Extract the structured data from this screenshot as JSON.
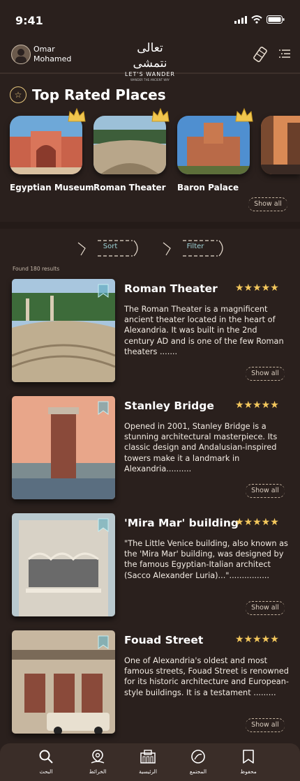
{
  "status": {
    "time": "9:41"
  },
  "header": {
    "user_name": "Omar Mohamed",
    "logo_ar": "تعالى نتمشى",
    "logo_en": "LET'S WANDER",
    "logo_sub": "WANDER THE ANCIENT WAY",
    "map_icon": "scroll-map-icon",
    "menu_icon": "menu-icon"
  },
  "top_rated": {
    "title": "Top Rated Places",
    "places": [
      {
        "name": "Egyptian Museum"
      },
      {
        "name": "Roman Theater"
      },
      {
        "name": "Baron Palace"
      },
      {
        "name": ""
      }
    ],
    "show_all": "Show all"
  },
  "controls": {
    "sort": "Sort",
    "filter": "Filter",
    "found": "Found 180 results"
  },
  "results": [
    {
      "name": "Roman Theater",
      "stars": "★★★★★",
      "desc": "The Roman Theater is a magnificent ancient theater located in the heart of Alexandria. It was built in the 2nd century AD and is one of the few Roman theaters .......",
      "show_all": "Show all"
    },
    {
      "name": "Stanley Bridge",
      "stars": "★★★★★",
      "desc": "Opened in 2001, Stanley Bridge is a stunning architectural masterpiece. Its classic design and Andalusian-inspired towers make it a landmark in Alexandria..........",
      "show_all": "Show all"
    },
    {
      "name": "'Mira Mar' building",
      "stars": "★★★★★",
      "desc": "\"The Little Venice building, also known as the 'Mira Mar' building, was designed by the famous Egyptian-Italian architect (Sacco Alexander Luria)...\"................",
      "show_all": "Show all"
    },
    {
      "name": "Fouad Street",
      "stars": "★★★★★",
      "desc": "One of Alexandria's oldest and most famous streets, Fouad Street is renowned for its historic architecture and European-style buildings. It is a testament .........",
      "show_all": "Show all"
    }
  ],
  "nav": [
    {
      "label": "البحث",
      "icon": "search-icon"
    },
    {
      "label": "الخرائط",
      "icon": "map-pin-icon"
    },
    {
      "label": "الرئيسية",
      "icon": "home-building-icon"
    },
    {
      "label": "المجتمع",
      "icon": "community-icon"
    },
    {
      "label": "محفوظ",
      "icon": "bookmark-icon"
    }
  ],
  "colors": {
    "background": "#2a201d",
    "accent_gold": "#f3c75c",
    "accent_teal": "#9cd2d6",
    "nav_bg": "#3a2d28"
  }
}
